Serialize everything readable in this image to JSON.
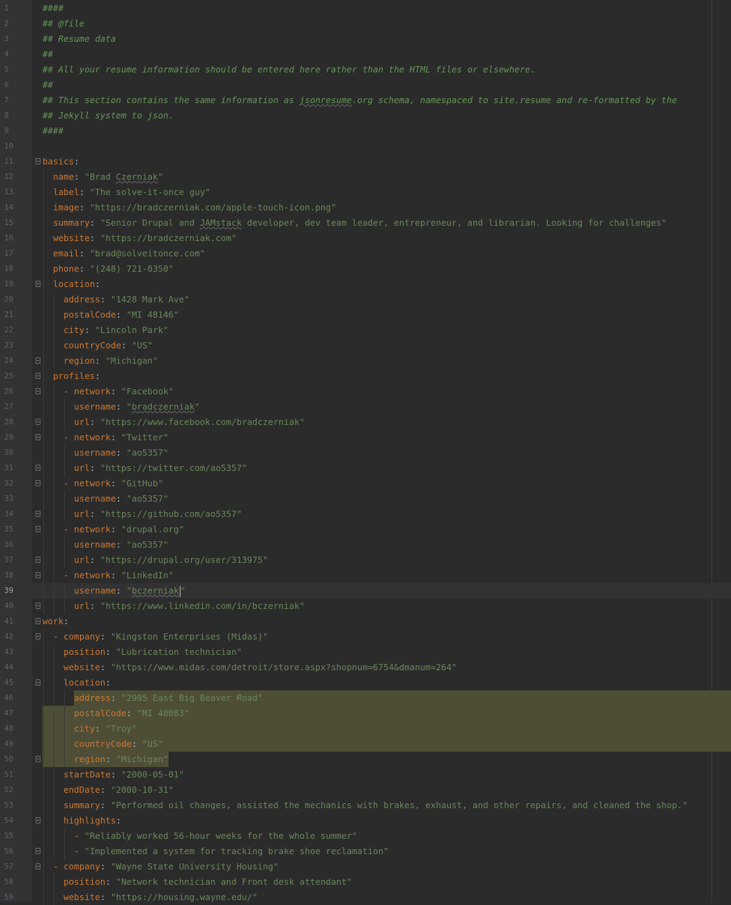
{
  "editor": {
    "current_line": 39,
    "selection": {
      "from_line": 46,
      "to_line": 50
    },
    "lines": [
      {
        "n": 1,
        "indent": 0,
        "fold": false,
        "tokens": [
          [
            "comment",
            "####"
          ]
        ]
      },
      {
        "n": 2,
        "indent": 0,
        "fold": false,
        "tokens": [
          [
            "comment",
            "## @file"
          ]
        ]
      },
      {
        "n": 3,
        "indent": 0,
        "fold": false,
        "tokens": [
          [
            "comment",
            "## Resume data"
          ]
        ]
      },
      {
        "n": 4,
        "indent": 0,
        "fold": false,
        "tokens": [
          [
            "comment",
            "##"
          ]
        ]
      },
      {
        "n": 5,
        "indent": 0,
        "fold": false,
        "tokens": [
          [
            "comment",
            "## All your resume information should be entered here rather than the HTML files or elsewhere."
          ]
        ]
      },
      {
        "n": 6,
        "indent": 0,
        "fold": false,
        "tokens": [
          [
            "comment",
            "##"
          ]
        ]
      },
      {
        "n": 7,
        "indent": 0,
        "fold": false,
        "tokens": [
          [
            "comment",
            "## This section contains the same information as "
          ],
          [
            "comment-typo",
            "jsonresume"
          ],
          [
            "comment",
            ".org schema, namespaced to site.resume and re-formatted by the"
          ]
        ]
      },
      {
        "n": 8,
        "indent": 0,
        "fold": false,
        "tokens": [
          [
            "comment",
            "## Jekyll system to json."
          ]
        ]
      },
      {
        "n": 9,
        "indent": 0,
        "fold": false,
        "tokens": [
          [
            "comment",
            "####"
          ]
        ]
      },
      {
        "n": 10,
        "indent": 0,
        "fold": false,
        "tokens": []
      },
      {
        "n": 11,
        "indent": 0,
        "fold": true,
        "tokens": [
          [
            "key",
            "basics"
          ],
          [
            "punct",
            ":"
          ]
        ]
      },
      {
        "n": 12,
        "indent": 1,
        "fold": false,
        "tokens": [
          [
            "key",
            "name"
          ],
          [
            "punct",
            ": "
          ],
          [
            "str",
            "\"Brad "
          ],
          [
            "str-typo",
            "Czerniak"
          ],
          [
            "str",
            "\""
          ]
        ]
      },
      {
        "n": 13,
        "indent": 1,
        "fold": false,
        "tokens": [
          [
            "key",
            "label"
          ],
          [
            "punct",
            ": "
          ],
          [
            "str",
            "\"The solve-it-once guy\""
          ]
        ]
      },
      {
        "n": 14,
        "indent": 1,
        "fold": false,
        "tokens": [
          [
            "key",
            "image"
          ],
          [
            "punct",
            ": "
          ],
          [
            "str",
            "\"https://bradczerniak.com/apple-touch-icon.png\""
          ]
        ]
      },
      {
        "n": 15,
        "indent": 1,
        "fold": false,
        "tokens": [
          [
            "key",
            "summary"
          ],
          [
            "punct",
            ": "
          ],
          [
            "str",
            "\"Senior Drupal and "
          ],
          [
            "str-typo",
            "JAMstack"
          ],
          [
            "str",
            " developer, dev team leader, entrepreneur, and librarian. Looking for challenges\""
          ]
        ]
      },
      {
        "n": 16,
        "indent": 1,
        "fold": false,
        "tokens": [
          [
            "key",
            "website"
          ],
          [
            "punct",
            ": "
          ],
          [
            "str",
            "\"https://bradczerniak.com\""
          ]
        ]
      },
      {
        "n": 17,
        "indent": 1,
        "fold": false,
        "tokens": [
          [
            "key",
            "email"
          ],
          [
            "punct",
            ": "
          ],
          [
            "str",
            "\"brad@solveitonce.com\""
          ]
        ]
      },
      {
        "n": 18,
        "indent": 1,
        "fold": false,
        "tokens": [
          [
            "key",
            "phone"
          ],
          [
            "punct",
            ": "
          ],
          [
            "str",
            "\"(248) 721-0350\""
          ]
        ]
      },
      {
        "n": 19,
        "indent": 1,
        "fold": true,
        "tokens": [
          [
            "key",
            "location"
          ],
          [
            "punct",
            ":"
          ]
        ]
      },
      {
        "n": 20,
        "indent": 2,
        "fold": false,
        "tokens": [
          [
            "key",
            "address"
          ],
          [
            "punct",
            ": "
          ],
          [
            "str",
            "\"1428 Mark Ave\""
          ]
        ]
      },
      {
        "n": 21,
        "indent": 2,
        "fold": false,
        "tokens": [
          [
            "key",
            "postalCode"
          ],
          [
            "punct",
            ": "
          ],
          [
            "str",
            "\"MI 48146\""
          ]
        ]
      },
      {
        "n": 22,
        "indent": 2,
        "fold": false,
        "tokens": [
          [
            "key",
            "city"
          ],
          [
            "punct",
            ": "
          ],
          [
            "str",
            "\"Lincoln Park\""
          ]
        ]
      },
      {
        "n": 23,
        "indent": 2,
        "fold": false,
        "tokens": [
          [
            "key",
            "countryCode"
          ],
          [
            "punct",
            ": "
          ],
          [
            "str",
            "\"US\""
          ]
        ]
      },
      {
        "n": 24,
        "indent": 2,
        "fold": true,
        "tokens": [
          [
            "key",
            "region"
          ],
          [
            "punct",
            ": "
          ],
          [
            "str",
            "\"Michigan\""
          ]
        ]
      },
      {
        "n": 25,
        "indent": 1,
        "fold": true,
        "tokens": [
          [
            "key",
            "profiles"
          ],
          [
            "punct",
            ":"
          ]
        ]
      },
      {
        "n": 26,
        "indent": 2,
        "fold": true,
        "tokens": [
          [
            "dash",
            "- "
          ],
          [
            "key",
            "network"
          ],
          [
            "punct",
            ": "
          ],
          [
            "str",
            "\"Facebook\""
          ]
        ]
      },
      {
        "n": 27,
        "indent": 3,
        "fold": false,
        "tokens": [
          [
            "key",
            "username"
          ],
          [
            "punct",
            ": "
          ],
          [
            "str",
            "\""
          ],
          [
            "str-typo",
            "bradczerniak"
          ],
          [
            "str",
            "\""
          ]
        ]
      },
      {
        "n": 28,
        "indent": 3,
        "fold": true,
        "tokens": [
          [
            "key",
            "url"
          ],
          [
            "punct",
            ": "
          ],
          [
            "str",
            "\"https://www.facebook.com/bradczerniak\""
          ]
        ]
      },
      {
        "n": 29,
        "indent": 2,
        "fold": true,
        "tokens": [
          [
            "dash",
            "- "
          ],
          [
            "key",
            "network"
          ],
          [
            "punct",
            ": "
          ],
          [
            "str",
            "\"Twitter\""
          ]
        ]
      },
      {
        "n": 30,
        "indent": 3,
        "fold": false,
        "tokens": [
          [
            "key",
            "username"
          ],
          [
            "punct",
            ": "
          ],
          [
            "str",
            "\"ao5357\""
          ]
        ]
      },
      {
        "n": 31,
        "indent": 3,
        "fold": true,
        "tokens": [
          [
            "key",
            "url"
          ],
          [
            "punct",
            ": "
          ],
          [
            "str",
            "\"https://twitter.com/ao5357\""
          ]
        ]
      },
      {
        "n": 32,
        "indent": 2,
        "fold": true,
        "tokens": [
          [
            "dash",
            "- "
          ],
          [
            "key",
            "network"
          ],
          [
            "punct",
            ": "
          ],
          [
            "str",
            "\"GitHub\""
          ]
        ]
      },
      {
        "n": 33,
        "indent": 3,
        "fold": false,
        "tokens": [
          [
            "key",
            "username"
          ],
          [
            "punct",
            ": "
          ],
          [
            "str",
            "\"ao5357\""
          ]
        ]
      },
      {
        "n": 34,
        "indent": 3,
        "fold": true,
        "tokens": [
          [
            "key",
            "url"
          ],
          [
            "punct",
            ": "
          ],
          [
            "str",
            "\"https://github.com/ao5357\""
          ]
        ]
      },
      {
        "n": 35,
        "indent": 2,
        "fold": true,
        "tokens": [
          [
            "dash",
            "- "
          ],
          [
            "key",
            "network"
          ],
          [
            "punct",
            ": "
          ],
          [
            "str",
            "\"drupal.org\""
          ]
        ]
      },
      {
        "n": 36,
        "indent": 3,
        "fold": false,
        "tokens": [
          [
            "key",
            "username"
          ],
          [
            "punct",
            ": "
          ],
          [
            "str",
            "\"ao5357\""
          ]
        ]
      },
      {
        "n": 37,
        "indent": 3,
        "fold": true,
        "tokens": [
          [
            "key",
            "url"
          ],
          [
            "punct",
            ": "
          ],
          [
            "str",
            "\"https://drupal.org/user/313975\""
          ]
        ]
      },
      {
        "n": 38,
        "indent": 2,
        "fold": true,
        "tokens": [
          [
            "dash",
            "- "
          ],
          [
            "key",
            "network"
          ],
          [
            "punct",
            ": "
          ],
          [
            "str",
            "\"LinkedIn\""
          ]
        ]
      },
      {
        "n": 39,
        "indent": 3,
        "fold": false,
        "tokens": [
          [
            "key",
            "username"
          ],
          [
            "punct",
            ": "
          ],
          [
            "str",
            "\""
          ],
          [
            "str-typo",
            "bczerniak"
          ],
          [
            "str",
            "\""
          ]
        ]
      },
      {
        "n": 40,
        "indent": 3,
        "fold": true,
        "tokens": [
          [
            "key",
            "url"
          ],
          [
            "punct",
            ": "
          ],
          [
            "str",
            "\"https://www.linkedin.com/in/bczerniak\""
          ]
        ]
      },
      {
        "n": 41,
        "indent": 0,
        "fold": true,
        "tokens": [
          [
            "key",
            "work"
          ],
          [
            "punct",
            ":"
          ]
        ]
      },
      {
        "n": 42,
        "indent": 1,
        "fold": true,
        "tokens": [
          [
            "dash",
            "- "
          ],
          [
            "key",
            "company"
          ],
          [
            "punct",
            ": "
          ],
          [
            "str",
            "\"Kingston Enterprises (Midas)\""
          ]
        ]
      },
      {
        "n": 43,
        "indent": 2,
        "fold": false,
        "tokens": [
          [
            "key",
            "position"
          ],
          [
            "punct",
            ": "
          ],
          [
            "str",
            "\"Lubrication technician\""
          ]
        ]
      },
      {
        "n": 44,
        "indent": 2,
        "fold": false,
        "tokens": [
          [
            "key",
            "website"
          ],
          [
            "punct",
            ": "
          ],
          [
            "str",
            "\"https://www.midas.com/detroit/store.aspx?shopnum=6754&dmanum=264\""
          ]
        ]
      },
      {
        "n": 45,
        "indent": 2,
        "fold": true,
        "tokens": [
          [
            "key",
            "location"
          ],
          [
            "punct",
            ":"
          ]
        ]
      },
      {
        "n": 46,
        "indent": 3,
        "fold": false,
        "tokens": [
          [
            "key",
            "address"
          ],
          [
            "punct",
            ": "
          ],
          [
            "str",
            "\"2995 East Big Beaver Road\""
          ]
        ]
      },
      {
        "n": 47,
        "indent": 3,
        "fold": false,
        "tokens": [
          [
            "key",
            "postalCode"
          ],
          [
            "punct",
            ": "
          ],
          [
            "str",
            "\"MI 48083\""
          ]
        ]
      },
      {
        "n": 48,
        "indent": 3,
        "fold": false,
        "tokens": [
          [
            "key",
            "city"
          ],
          [
            "punct",
            ": "
          ],
          [
            "str",
            "\"Troy\""
          ]
        ]
      },
      {
        "n": 49,
        "indent": 3,
        "fold": false,
        "tokens": [
          [
            "key",
            "countryCode"
          ],
          [
            "punct",
            ": "
          ],
          [
            "str",
            "\"US\""
          ]
        ]
      },
      {
        "n": 50,
        "indent": 3,
        "fold": true,
        "tokens": [
          [
            "key",
            "region"
          ],
          [
            "punct",
            ": "
          ],
          [
            "str",
            "\"Michigan\""
          ]
        ]
      },
      {
        "n": 51,
        "indent": 2,
        "fold": false,
        "tokens": [
          [
            "key",
            "startDate"
          ],
          [
            "punct",
            ": "
          ],
          [
            "str",
            "\"2000-05-01\""
          ]
        ]
      },
      {
        "n": 52,
        "indent": 2,
        "fold": false,
        "tokens": [
          [
            "key",
            "endDate"
          ],
          [
            "punct",
            ": "
          ],
          [
            "str",
            "\"2000-10-31\""
          ]
        ]
      },
      {
        "n": 53,
        "indent": 2,
        "fold": false,
        "tokens": [
          [
            "key",
            "summary"
          ],
          [
            "punct",
            ": "
          ],
          [
            "str",
            "\"Performed oil changes, assisted the mechanics with brakes, exhaust, and other repairs, and cleaned the shop.\""
          ]
        ]
      },
      {
        "n": 54,
        "indent": 2,
        "fold": true,
        "tokens": [
          [
            "key",
            "highlights"
          ],
          [
            "punct",
            ":"
          ]
        ]
      },
      {
        "n": 55,
        "indent": 3,
        "fold": false,
        "tokens": [
          [
            "dash",
            "- "
          ],
          [
            "str",
            "\"Reliably worked 56-hour weeks for the whole summer\""
          ]
        ]
      },
      {
        "n": 56,
        "indent": 3,
        "fold": true,
        "tokens": [
          [
            "dash",
            "- "
          ],
          [
            "str",
            "\"Implemented a system for tracking brake shoe reclamation\""
          ]
        ]
      },
      {
        "n": 57,
        "indent": 1,
        "fold": true,
        "tokens": [
          [
            "dash",
            "- "
          ],
          [
            "key",
            "company"
          ],
          [
            "punct",
            ": "
          ],
          [
            "str",
            "\"Wayne State University Housing\""
          ]
        ]
      },
      {
        "n": 58,
        "indent": 2,
        "fold": false,
        "tokens": [
          [
            "key",
            "position"
          ],
          [
            "punct",
            ": "
          ],
          [
            "str",
            "\"Network technician and Front desk attendant\""
          ]
        ]
      },
      {
        "n": 59,
        "indent": 2,
        "fold": false,
        "tokens": [
          [
            "key",
            "website"
          ],
          [
            "punct",
            ": "
          ],
          [
            "str",
            "\"https://housing.wayne.edu/\""
          ]
        ]
      }
    ]
  }
}
